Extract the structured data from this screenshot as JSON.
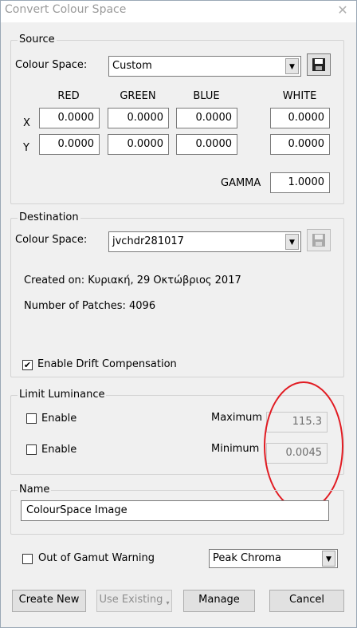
{
  "window": {
    "title": "Convert Colour Space",
    "close_icon": "✕"
  },
  "source": {
    "group_label": "Source",
    "colour_space_label": "Colour Space:",
    "colour_space_value": "Custom",
    "columns": [
      "RED",
      "GREEN",
      "BLUE",
      "WHITE"
    ],
    "rows": [
      {
        "label": "X",
        "values": [
          "0.0000",
          "0.0000",
          "0.0000",
          "0.0000"
        ]
      },
      {
        "label": "Y",
        "values": [
          "0.0000",
          "0.0000",
          "0.0000",
          "0.0000"
        ]
      }
    ],
    "gamma_label": "GAMMA",
    "gamma_value": "1.0000"
  },
  "destination": {
    "group_label": "Destination",
    "colour_space_label": "Colour Space:",
    "colour_space_value": "jvchdr281017",
    "created_on": "Created on: Κυριακή, 29 Οκτώβριος 2017",
    "patches": "Number of Patches: 4096",
    "drift_label": "Enable Drift Compensation",
    "drift_checked": true
  },
  "limit_luminance": {
    "group_label": "Limit Luminance",
    "max_enable_label": "Enable",
    "max_label": "Maximum",
    "max_value": "115.3",
    "min_enable_label": "Enable",
    "min_label": "Minimum",
    "min_value": "0.0045"
  },
  "name_group": {
    "group_label": "Name",
    "value": "ColourSpace Image"
  },
  "gamut": {
    "label": "Out of Gamut Warning",
    "mode": "Peak Chroma"
  },
  "buttons": {
    "create_new": "Create New",
    "use_existing": "Use Existing",
    "manage": "Manage",
    "cancel": "Cancel"
  },
  "colors": {
    "annotation": "#e11b22",
    "disabled_text": "#6d6d6d"
  },
  "icons": {
    "save": "floppy-disk-icon",
    "dropdown": "chevron-down-icon",
    "check": "checkmark-icon"
  }
}
